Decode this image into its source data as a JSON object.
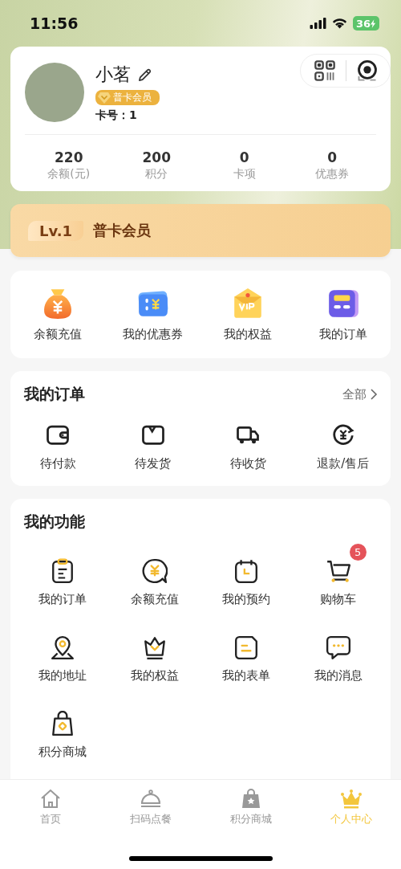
{
  "status_bar": {
    "time": "11:56",
    "battery": "36"
  },
  "profile": {
    "name": "小茗",
    "badge": "普卡会员",
    "card_number": "卡号：1",
    "stats": [
      {
        "value": "220",
        "label": "余额(元)"
      },
      {
        "value": "200",
        "label": "积分"
      },
      {
        "value": "0",
        "label": "卡项"
      },
      {
        "value": "0",
        "label": "优惠券"
      }
    ]
  },
  "level_banner": {
    "level": "Lv.1",
    "title": "普卡会员"
  },
  "quick_actions": [
    {
      "label": "余额充值"
    },
    {
      "label": "我的优惠券"
    },
    {
      "label": "我的权益"
    },
    {
      "label": "我的订单"
    }
  ],
  "orders": {
    "title": "我的订单",
    "more": "全部",
    "items": [
      {
        "label": "待付款"
      },
      {
        "label": "待发货"
      },
      {
        "label": "待收货"
      },
      {
        "label": "退款/售后"
      }
    ]
  },
  "functions": {
    "title": "我的功能",
    "items": [
      {
        "label": "我的订单"
      },
      {
        "label": "余额充值"
      },
      {
        "label": "我的预约"
      },
      {
        "label": "购物车",
        "badge": "5"
      },
      {
        "label": "我的地址"
      },
      {
        "label": "我的权益"
      },
      {
        "label": "我的表单"
      },
      {
        "label": "我的消息"
      },
      {
        "label": "积分商城"
      }
    ]
  },
  "tab_bar": [
    {
      "label": "首页",
      "selected": false
    },
    {
      "label": "扫码点餐",
      "selected": false
    },
    {
      "label": "积分商城",
      "selected": false
    },
    {
      "label": "个人中心",
      "selected": true
    }
  ]
}
